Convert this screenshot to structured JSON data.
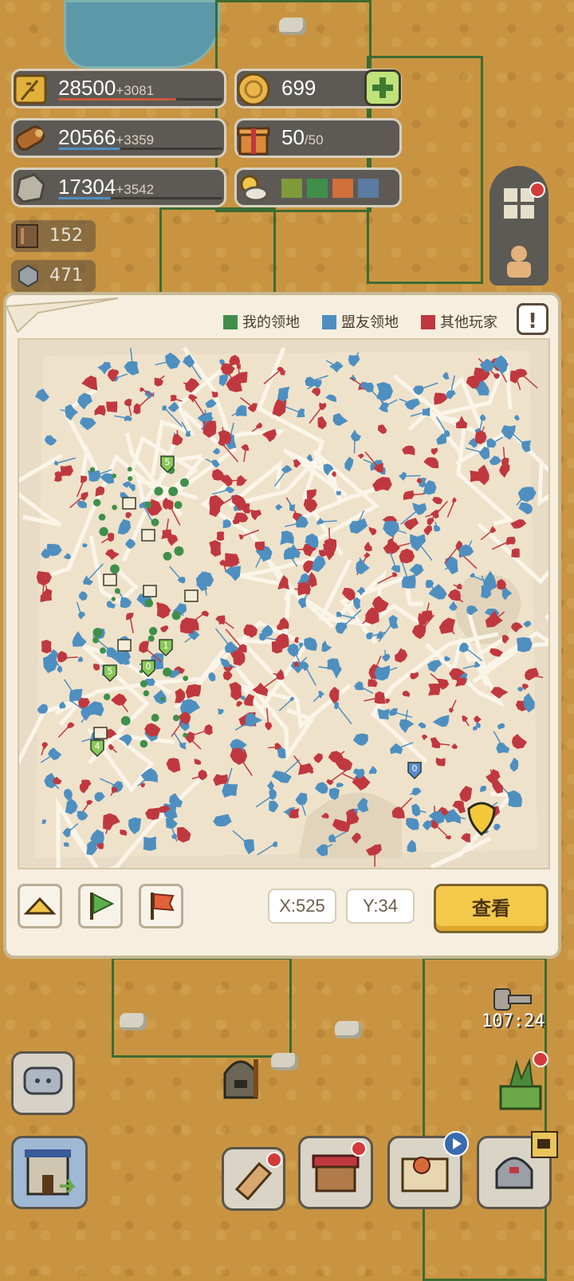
{
  "colors": {
    "my_territory": "#3f8f4a",
    "ally_territory": "#4e8fc0",
    "other_players": "#c0383f"
  },
  "resources": [
    {
      "icon": "wheat-icon",
      "value": "28500",
      "increase": "+3081",
      "bar_color": "#c75a3a",
      "fill": 0.72
    },
    {
      "icon": "wood-icon",
      "value": "20566",
      "increase": "+3359",
      "bar_color": "#4e8fc0",
      "fill": 0.38
    },
    {
      "icon": "stone-icon",
      "value": "17304",
      "increase": "+3542",
      "bar_color": "#4e8fc0",
      "fill": 0.32
    }
  ],
  "gold": {
    "icon": "gold-coin-icon",
    "value": "699",
    "add_icon": "plus-icon"
  },
  "gift": {
    "icon": "gift-icon",
    "value": "50",
    "max": "/50"
  },
  "weather": {
    "icon": "weather-icon",
    "swatches": [
      "#7e9a3a",
      "#3f8f4a",
      "#d0703a",
      "#5a7aa0"
    ]
  },
  "items": [
    {
      "icon": "book-icon",
      "value": "152"
    },
    {
      "icon": "iron-ore-icon",
      "value": "471"
    }
  ],
  "legend": {
    "my": "我的领地",
    "ally": "盟友领地",
    "other": "其他玩家"
  },
  "coords": {
    "x": "X:525",
    "y": "Y:34"
  },
  "view_button": "查看",
  "timer": "107:24",
  "map_markers": [
    {
      "label": "5",
      "kind": "green"
    },
    {
      "label": "1",
      "kind": "green"
    },
    {
      "label": "5",
      "kind": "green"
    },
    {
      "label": "0",
      "kind": "green"
    },
    {
      "label": "4",
      "kind": "green"
    },
    {
      "label": "0",
      "kind": "blue"
    }
  ]
}
